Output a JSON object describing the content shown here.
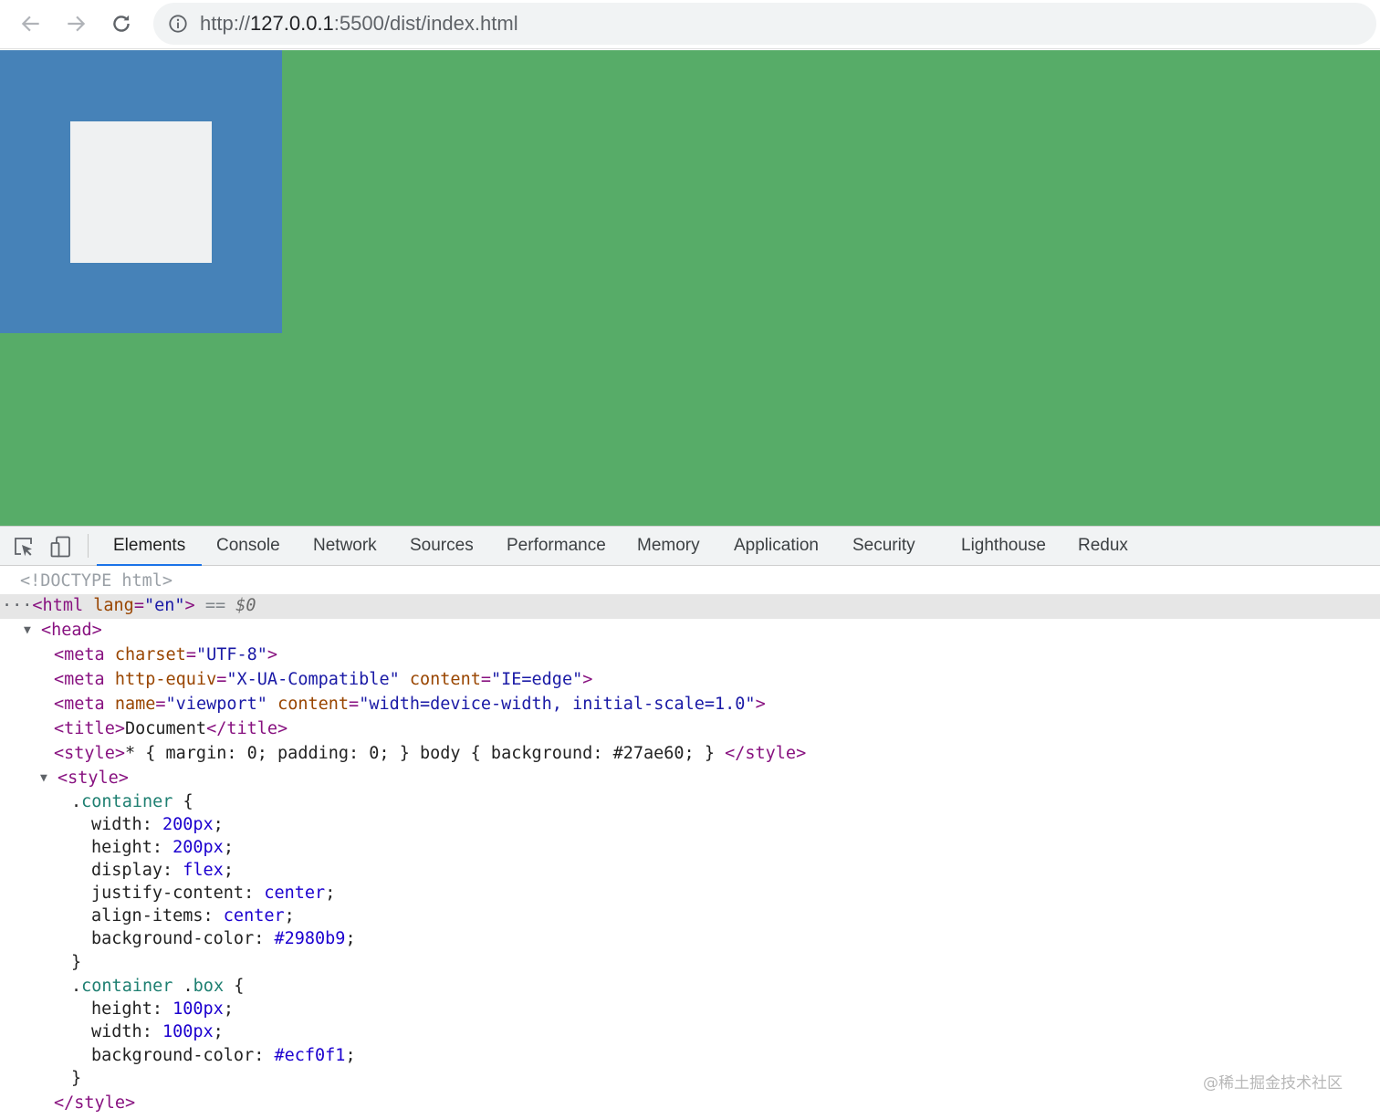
{
  "browser": {
    "url_scheme": "http://",
    "url_host": "127.0.0.1",
    "url_rest": ":5500/dist/index.html"
  },
  "viewport": {
    "body_background": "#57ac68",
    "container_color": "#4682b8",
    "box_color": "#eff1f2"
  },
  "devtools": {
    "tabs": [
      "Elements",
      "Console",
      "Network",
      "Sources",
      "Performance",
      "Memory",
      "Application",
      "Security",
      "Lighthouse",
      "Redux"
    ],
    "active_tab": "Elements",
    "dom": {
      "doctype": "<!DOCTYPE html>",
      "html_tag_open": "<html",
      "html_attr": "lang",
      "html_attr_val": "\"en\"",
      "html_close": ">",
      "eq": "==",
      "dollar": "$0",
      "head_open": "<head>",
      "meta1_open": "<meta",
      "meta1_attr": "charset",
      "meta1_val": "\"UTF-8\"",
      "meta1_close": ">",
      "meta2_open": "<meta",
      "meta2_attr1": "http-equiv",
      "meta2_val1": "\"X-UA-Compatible\"",
      "meta2_attr2": "content",
      "meta2_val2": "\"IE=edge\"",
      "meta2_close": ">",
      "meta3_open": "<meta",
      "meta3_attr1": "name",
      "meta3_val1": "\"viewport\"",
      "meta3_attr2": "content",
      "meta3_val2": "\"width=device-width, initial-scale=1.0\"",
      "meta3_close": ">",
      "title_open": "<title>",
      "title_text": "Document",
      "title_close": "</title>",
      "style1_open": "<style>",
      "style1_text": "* { margin: 0; padding: 0; } body { background: #27ae60; } ",
      "style1_close": "</style>",
      "style2_open": "<style>",
      "rule1_selector": "container",
      "width_prop": "width: ",
      "width_num": "200",
      "width_unit": "px",
      "height_prop": "height: ",
      "height_num": "200",
      "height_unit": "px",
      "display_prop": "display: ",
      "display_val": "flex",
      "justify_prop": "justify-content: ",
      "justify_val": "center",
      "align_prop": "align-items: ",
      "align_val": "center",
      "bg_prop": "background-color: ",
      "bg_val": "#2980b9",
      "rule2_sel1": "container",
      "rule2_sel2": "box",
      "h2_prop": "height: ",
      "h2_num": "100",
      "h2_unit": "px",
      "w2_prop": "width: ",
      "w2_num": "100",
      "w2_unit": "px",
      "bg2_prop": "background-color: ",
      "bg2_val": "#ecf0f1",
      "style2_close": "</style>"
    }
  },
  "watermark": "@稀土掘金技术社区",
  "colors": {
    "accent_tab": "#1a73e8",
    "tag": "#881280",
    "attr": "#994500",
    "value": "#1a1aa6",
    "number": "#1c00cf",
    "selector": "#1e7f71"
  },
  "icons": [
    "back-arrow-icon",
    "forward-arrow-icon",
    "reload-icon",
    "info-icon",
    "inspect-element-icon",
    "device-toggle-icon"
  ]
}
